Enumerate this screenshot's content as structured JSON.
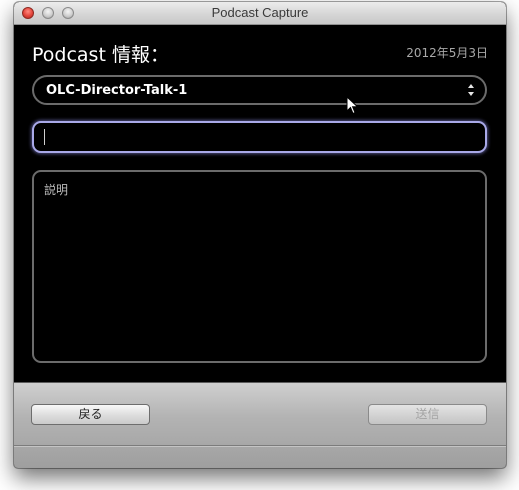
{
  "window": {
    "title": "Podcast Capture"
  },
  "header": {
    "title": "Podcast 情報：",
    "date": "2012年5月3日"
  },
  "podcast_select": {
    "value": "OLC-Director-Talk-1",
    "icon": "up-down-chevron-icon"
  },
  "title_field": {
    "value": "",
    "placeholder": ""
  },
  "description_field": {
    "value": "",
    "placeholder": "説明"
  },
  "footer": {
    "back_label": "戻る",
    "send_label": "送信",
    "send_enabled": false
  },
  "colors": {
    "content_background": "#000000",
    "focus_ring": "#a9a9e8",
    "field_border": "#6b6b6b",
    "disabled_text": "#a4a4a4"
  }
}
